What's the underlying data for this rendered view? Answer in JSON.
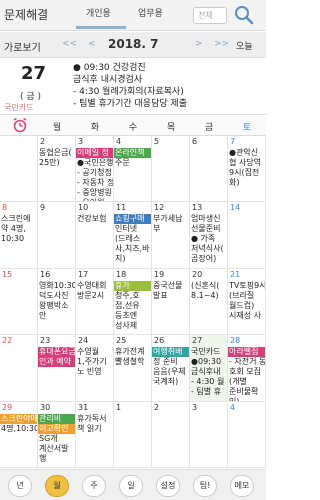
{
  "topbar": {
    "app_title": "문제해결",
    "tabs": [
      "개인용",
      "업무용"
    ],
    "search_placeholder": "전체"
  },
  "navbar": {
    "view_label": "가로보기",
    "prev_year": "<<",
    "prev_month": "<",
    "month": "2018. 7",
    "next_month": ">",
    "next_year": ">>",
    "today_label": "오늘"
  },
  "dayinfo": {
    "day": "27",
    "weekday": "( 금 )",
    "holiday": "국민카드",
    "events": [
      "● 09:30 건강검진",
      "  금식후 내시경검사",
      "- 4:30 월례가회의(자료복사)",
      "- 팀별 휴가기간 대응담당 제출"
    ]
  },
  "weekdays": [
    "월",
    "화",
    "수",
    "목",
    "금",
    "토"
  ],
  "weeks": [
    [
      {
        "day": "",
        "events": []
      },
      {
        "day": "2",
        "events": [
          "동협은금(",
          "25만)"
        ]
      },
      {
        "day": "3",
        "tags": [
          {
            "t": "이메일 정",
            "c": "pink"
          }
        ],
        "events": [
          "●국민은행",
          "- 공기청정",
          "- 자동차 정",
          "- 중앙병원",
          "- 유이원 "
        ]
      },
      {
        "day": "4",
        "tags": [
          {
            "t": "온라인책",
            "c": "green"
          }
        ],
        "events": [
          "주문"
        ]
      },
      {
        "day": "5",
        "events": []
      },
      {
        "day": "6",
        "events": []
      },
      {
        "day": "7",
        "events": [
          "●관악신",
          "협 사당역",
          "9시(집전",
          "화)"
        ]
      }
    ],
    [
      {
        "day": "8",
        "events": [
          "스크린에",
          "약 4명,",
          "10:30"
        ]
      },
      {
        "day": "9",
        "events": []
      },
      {
        "day": "10",
        "events": [
          "건강보험"
        ]
      },
      {
        "day": "11",
        "tags": [
          {
            "t": "쇼핑구매",
            "c": "blue"
          }
        ],
        "events": [
          "인터넷",
          "(드레스",
          "사,치즈,바",
          "지)"
        ]
      },
      {
        "day": "12",
        "events": [
          "부가세납",
          "부"
        ]
      },
      {
        "day": "13",
        "events": [
          "엄마생신",
          "선물준비",
          "● 가족",
          "저녁식사(",
          "곰장어)"
        ]
      },
      {
        "day": "14",
        "events": []
      }
    ],
    [
      {
        "day": "15",
        "events": []
      },
      {
        "day": "16",
        "events": [
          "영화10:30",
          "덕도사진",
          "왕팽박소",
          "안"
        ]
      },
      {
        "day": "17",
        "events": [
          "수영대회",
          "방문2시"
        ]
      },
      {
        "day": "18",
        "tags": [
          {
            "t": "휴가",
            "c": "olive"
          }
        ],
        "events": [
          "청주,호",
          "접,선유",
          "등초엔",
          "성사제"
        ]
      },
      {
        "day": "19",
        "events": [
          "중국선물",
          "발표"
        ]
      },
      {
        "day": "20",
        "events": [
          "(신혼식(",
          "8.1~4)"
        ]
      },
      {
        "day": "21",
        "events": [
          "TV토핑9시",
          "(브라질",
          "월드컵)",
          "시재성 사"
        ]
      }
    ],
    [
      {
        "day": "22",
        "events": []
      },
      {
        "day": "23",
        "tags": [
          {
            "t": "휴대폰요금",
            "c": "pink"
          },
          {
            "t": "인과 예약",
            "c": "pink"
          }
        ],
        "events": []
      },
      {
        "day": "24",
        "events": [
          "수영월",
          "1,주가기",
          "노 빈영"
        ]
      },
      {
        "day": "25",
        "events": [
          "휴가전계",
          "빨생철학"
        ]
      },
      {
        "day": "26",
        "tags": [
          {
            "t": "여행취배",
            "c": "teal"
          }
        ],
        "events": [
          "정 준비",
          "음음(우체",
          "국계좌)"
        ]
      },
      {
        "day": "27",
        "today": true,
        "events": [
          "국민카드",
          "●09:30",
          "금식후내",
          "- 4:30 월",
          "- 팀별 휴"
        ]
      },
      {
        "day": "28",
        "tags": [
          {
            "t": "아라벨집",
            "c": "pink"
          }
        ],
        "events": [
          "- 자전거 동",
          "호회 모집",
          "(개별",
          "준비물확",
          "인)"
        ]
      }
    ],
    [
      {
        "day": "29",
        "tags": [
          {
            "t": "스크린야메",
            "c": "orange"
          }
        ],
        "events": [
          "4명,10:30"
        ]
      },
      {
        "day": "30",
        "tags": [
          {
            "t": "관리비",
            "c": "green"
          },
          {
            "t": "이고확인",
            "c": "orange"
          }
        ],
        "events": [
          "SG개",
          "계산서발",
          "행"
        ]
      },
      {
        "day": "31",
        "events": [
          "휴가독서",
          "책 읽기"
        ]
      },
      {
        "day": "1",
        "events": []
      },
      {
        "day": "2",
        "events": []
      },
      {
        "day": "3",
        "events": []
      },
      {
        "day": "4",
        "events": []
      }
    ]
  ],
  "bottombar": [
    "년",
    "월",
    "주",
    "일",
    "설정",
    "팁!",
    "메모"
  ],
  "colors": {
    "accent": "#8ab2d0",
    "today_bg": "#eef7ea",
    "sunday": "#e05050",
    "saturday": "#3a8ad0"
  }
}
